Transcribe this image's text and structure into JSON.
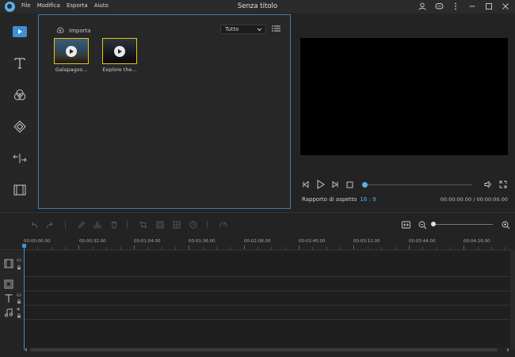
{
  "window": {
    "title": "Senza titolo",
    "menu": [
      "File",
      "Modifica",
      "Esporta",
      "Aiuto"
    ]
  },
  "sidebar": {
    "items": [
      {
        "icon": "media-icon",
        "active": true
      },
      {
        "icon": "text-icon"
      },
      {
        "icon": "filters-icon"
      },
      {
        "icon": "overlay-icon"
      },
      {
        "icon": "transitions-icon"
      },
      {
        "icon": "film-icon"
      }
    ]
  },
  "media": {
    "import_label": "Importa",
    "filter_value": "Tutto",
    "items": [
      {
        "label": "Galapagos..."
      },
      {
        "label": "Explore the..."
      }
    ]
  },
  "preview": {
    "ratio_label": "Rapporto di aspetto",
    "ratio_value": "16 : 9",
    "timecode": "00:00:00.00 / 00:00:00.00"
  },
  "timeline": {
    "ruler": [
      "00:00:00.00",
      "00:00:32.00",
      "00:01:04.00",
      "00:01:36.00",
      "00:02:08.00",
      "00:02:40.00",
      "00:03:12.00",
      "00:03:44.00",
      "00:04:16.00"
    ]
  },
  "colors": {
    "accent": "#5ab0e8",
    "selection": "#e8c800",
    "panel_border": "#3f7cad"
  }
}
